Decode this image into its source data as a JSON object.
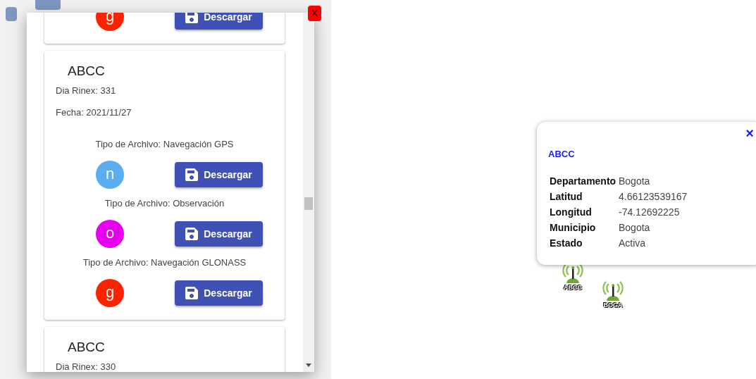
{
  "close_button": {
    "label": "X"
  },
  "stations_panel": {
    "cards": [
      {
        "files": [
          {
            "letter": "g",
            "color": "#ff2200",
            "download": "Descargar"
          }
        ]
      },
      {
        "title": "ABCC",
        "dia_rinex": "Dia Rinex: 331",
        "fecha": "Fecha: 2021/11/27",
        "files": [
          {
            "type": "Tipo de Archivo: Navegación GPS",
            "letter": "n",
            "color": "#5aaef0",
            "download": "Descargar"
          },
          {
            "type": "Tipo de Archivo: Observación",
            "letter": "o",
            "color": "#e600f0",
            "download": "Descargar"
          },
          {
            "type": "Tipo de Archivo: Navegación GLONASS",
            "letter": "g",
            "color": "#ff2200",
            "download": "Descargar"
          }
        ]
      },
      {
        "title": "ABCC",
        "dia_rinex": "Dia Rinex: 330"
      }
    ]
  },
  "popup": {
    "close": "×",
    "title": "ABCC",
    "rows": [
      {
        "label": "Departamento",
        "value": "Bogota"
      },
      {
        "label": "Latitud",
        "value": "4.66123539167"
      },
      {
        "label": "Longitud",
        "value": "-74.12692225"
      },
      {
        "label": "Municipio",
        "value": "Bogota"
      },
      {
        "label": "Estado",
        "value": "Activa"
      }
    ]
  },
  "map_markers": [
    {
      "label": "ABCC"
    },
    {
      "label": "BOGA"
    }
  ]
}
